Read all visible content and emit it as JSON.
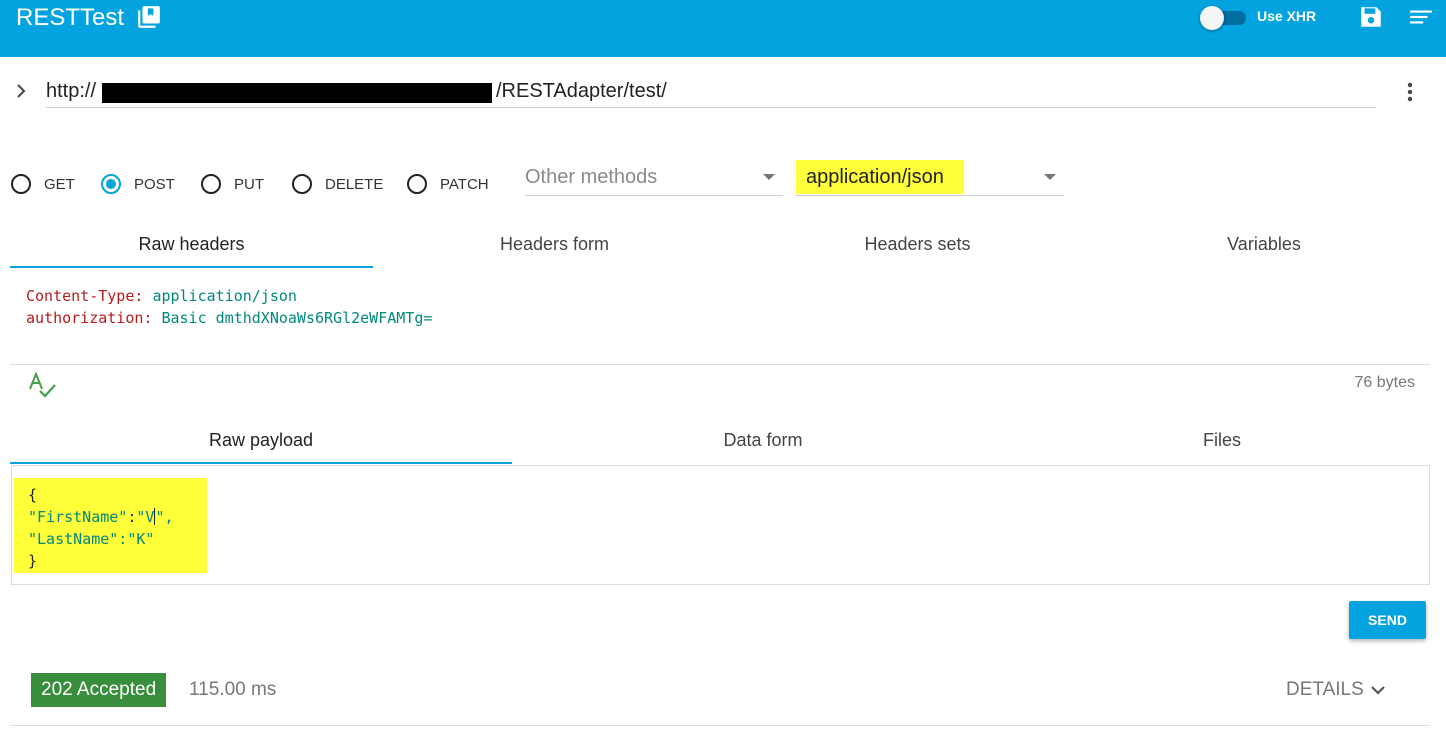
{
  "app": {
    "title": "RESTTest",
    "use_xhr_label": "Use XHR",
    "use_xhr_enabled": false,
    "accent_color": "#03a3e0"
  },
  "request": {
    "url_prefix": "http://",
    "url_suffix": "/RESTAdapter/test/",
    "methods": [
      {
        "label": "GET",
        "selected": false
      },
      {
        "label": "POST",
        "selected": true
      },
      {
        "label": "PUT",
        "selected": false
      },
      {
        "label": "DELETE",
        "selected": false
      },
      {
        "label": "PATCH",
        "selected": false
      }
    ],
    "other_methods_placeholder": "Other methods",
    "content_type": "application/json"
  },
  "headers": {
    "tabs": [
      "Raw headers",
      "Headers form",
      "Headers sets",
      "Variables"
    ],
    "active_tab": 0,
    "lines": [
      {
        "key": "Content-Type",
        "value": "application/json"
      },
      {
        "key": "authorization",
        "value": "Basic dmthdXNoaWs6RGl2eWFAMTg="
      }
    ]
  },
  "payload": {
    "size": "76 bytes",
    "tabs": [
      "Raw payload",
      "Data form",
      "Files"
    ],
    "active_tab": 0,
    "open_brace": "{",
    "first_key": "\"FirstName\"",
    "first_value_start": "\"V",
    "first_value_end": "\",",
    "second_line": "\"LastName\":\"K\"",
    "close_brace": "}"
  },
  "actions": {
    "send_label": "SEND"
  },
  "response": {
    "status": "202 Accepted",
    "status_color": "#388e3c",
    "time": "115.00 ms",
    "details_label": "DETAILS"
  }
}
